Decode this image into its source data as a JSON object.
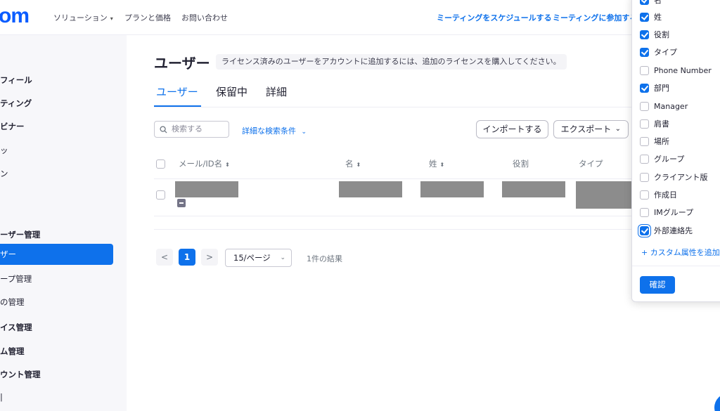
{
  "brand": {
    "logo_text": "om",
    "accent": "#0e71eb"
  },
  "topnav": {
    "solutions": "ソリューション",
    "plans": "プランと価格",
    "contact": "お問い合わせ",
    "schedule": "ミーティングをスケジュールする",
    "join": "ミーティングに参加する"
  },
  "sidebar": {
    "items": [
      "フィール",
      "ティング",
      "ビナー",
      "ッ",
      "ン",
      "ーザー管理",
      "ザー",
      "ープ管理",
      "の管理",
      "イス管理",
      "ム管理",
      "ウント管理",
      "|"
    ],
    "active_index": 6
  },
  "main": {
    "title": "ユーザー",
    "license_note": "ライセンス済みのユーザーをアカウントに追加するには、追加のライセンスを購入してください。",
    "tabs": [
      "ユーザー",
      "保留中",
      "詳細"
    ],
    "search_placeholder": "検索する",
    "advanced_search": "詳細な検索条件",
    "import_label": "インポートする",
    "export_label": "エクスポート",
    "columns": [
      "メール/ID名",
      "名",
      "姓",
      "役割",
      "タイプ"
    ],
    "pagination": {
      "prev": "<",
      "current": "1",
      "next": ">",
      "per_page": "15/ページ",
      "result_count": "1件の結果"
    }
  },
  "column_popup": {
    "options": [
      {
        "label": "名",
        "checked": true
      },
      {
        "label": "姓",
        "checked": true
      },
      {
        "label": "役割",
        "checked": true
      },
      {
        "label": "タイプ",
        "checked": true
      },
      {
        "label": "Phone Number",
        "checked": false
      },
      {
        "label": "部門",
        "checked": true
      },
      {
        "label": "Manager",
        "checked": false
      },
      {
        "label": "肩書",
        "checked": false
      },
      {
        "label": "場所",
        "checked": false
      },
      {
        "label": "グループ",
        "checked": false
      },
      {
        "label": "クライアント版",
        "checked": false
      },
      {
        "label": "作成日",
        "checked": false
      },
      {
        "label": "IMグループ",
        "checked": false
      },
      {
        "label": "外部連絡先",
        "checked": true
      }
    ],
    "add_custom": "+ カスタム属性を追加",
    "confirm": "確認"
  }
}
